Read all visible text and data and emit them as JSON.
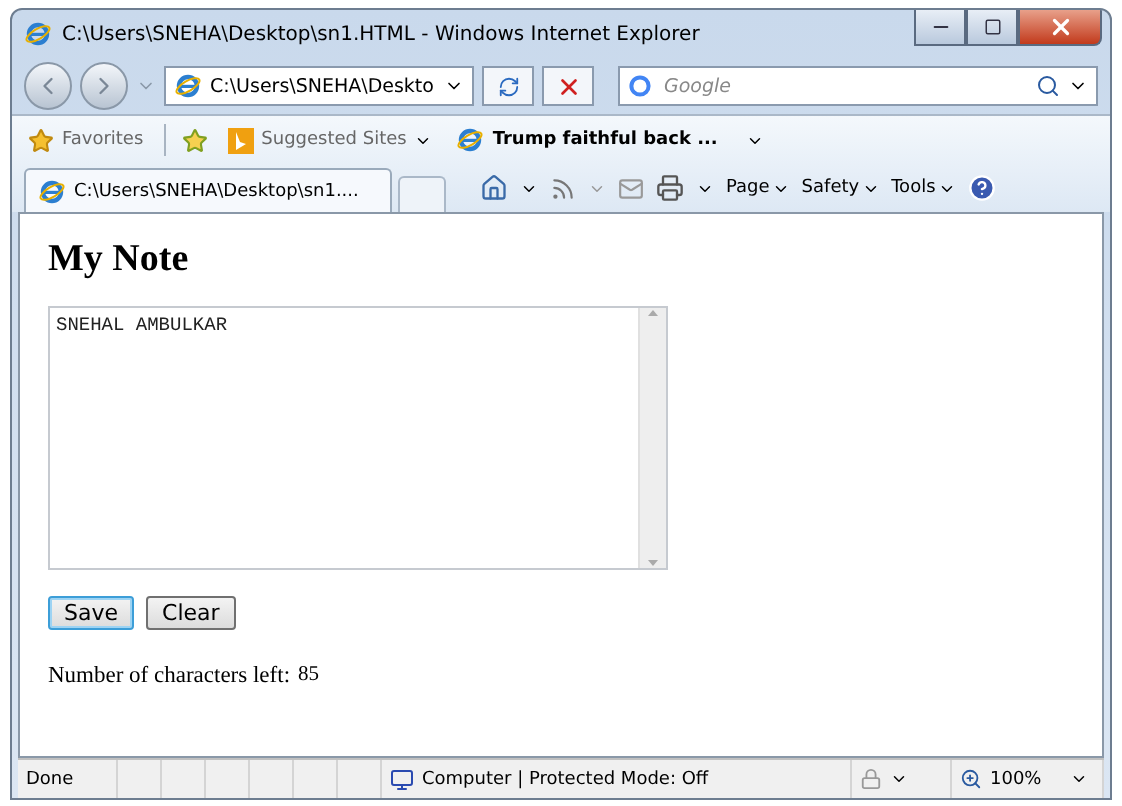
{
  "window": {
    "title": "C:\\Users\\SNEHA\\Desktop\\sn1.HTML - Windows Internet Explorer"
  },
  "address_bar": {
    "value": "C:\\Users\\SNEHA\\Deskto"
  },
  "search": {
    "placeholder": "Google"
  },
  "favorites_bar": {
    "favorites": "Favorites",
    "items": [
      {
        "label": "Suggested Sites",
        "bold": false
      },
      {
        "label": "Trump faithful back ...",
        "bold": true
      }
    ]
  },
  "tabs": [
    {
      "label": "C:\\Users\\SNEHA\\Desktop\\sn1....",
      "selected": true
    }
  ],
  "command_bar": {
    "menus": [
      "Page",
      "Safety",
      "Tools"
    ]
  },
  "page": {
    "heading": "My Note",
    "note": {
      "value": "SNEHAL AMBULKAR"
    },
    "buttons": [
      {
        "label": "Save",
        "focused": true
      },
      {
        "label": "Clear",
        "focused": false
      }
    ],
    "counter_label": "Number of characters left:",
    "counter_value": "85"
  },
  "status_bar": {
    "status": "Done",
    "zone": "Computer | Protected Mode: Off",
    "zoom": "100%"
  }
}
